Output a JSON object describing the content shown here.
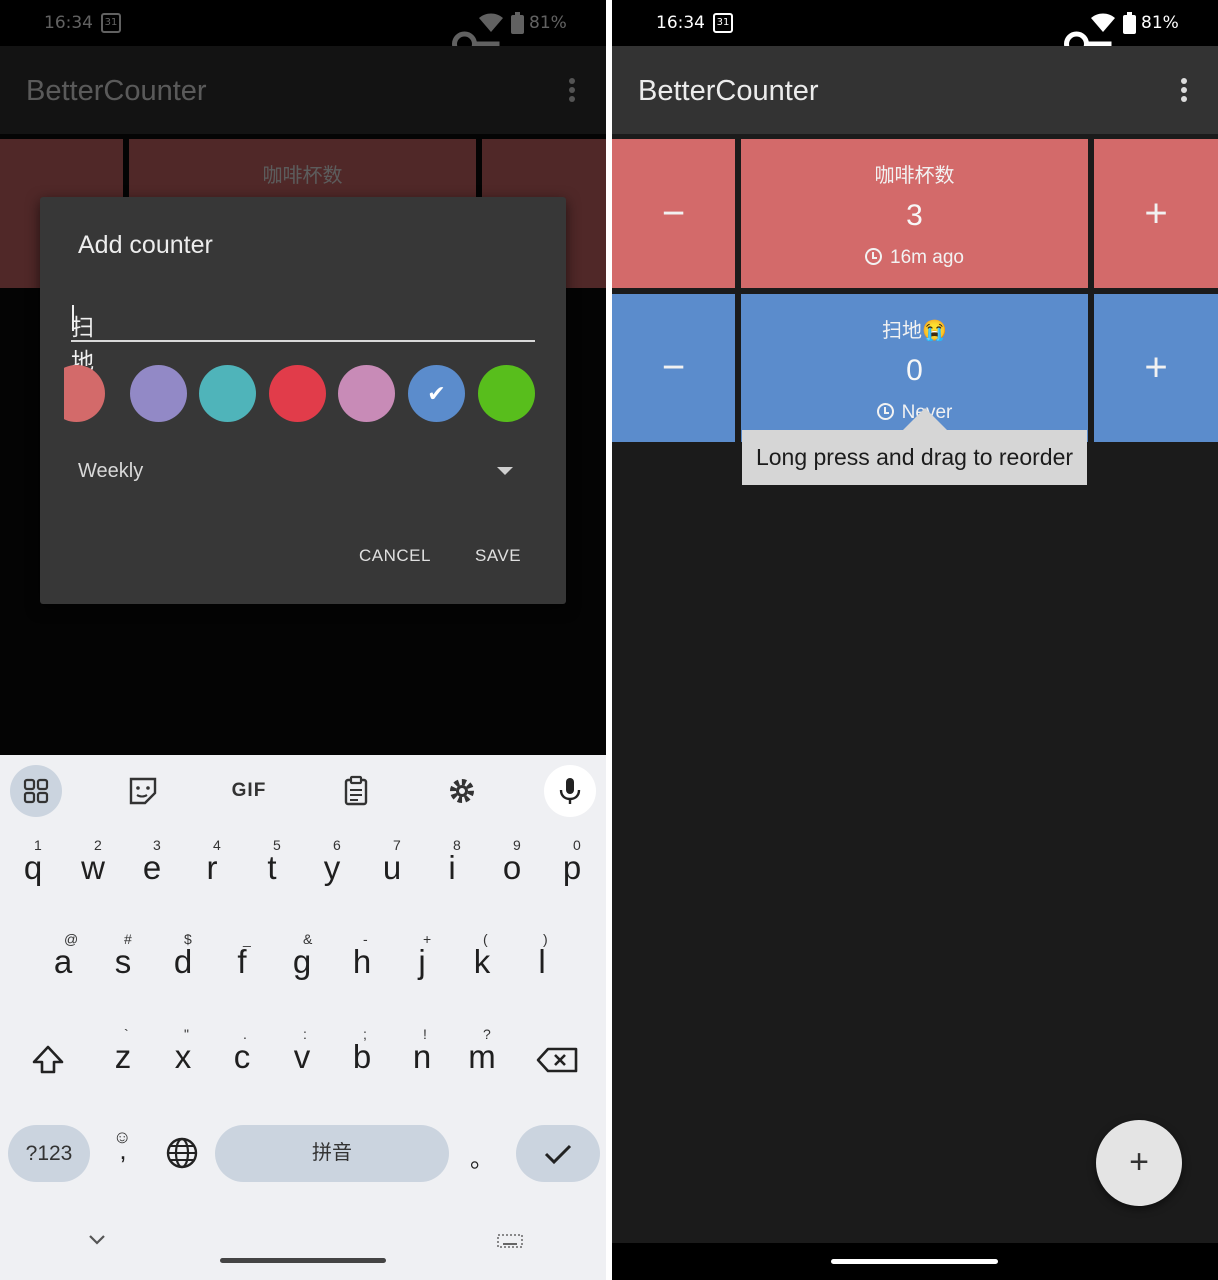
{
  "status": {
    "time": "16:34",
    "calendar_day": "31",
    "battery": "81%"
  },
  "app": {
    "title": "BetterCounter"
  },
  "counters": [
    {
      "name": "咖啡杯数",
      "count": "3",
      "last": "16m ago",
      "color": "#d36a6a",
      "minus": "−",
      "plus": "+"
    },
    {
      "name": "扫地😭",
      "count": "0",
      "last": "Never",
      "color": "#5b8ccc",
      "minus": "−",
      "plus": "+"
    }
  ],
  "dialog": {
    "title": "Add counter",
    "input_value": "扫地😭",
    "colors": [
      "#d36a6a",
      "#9289c6",
      "#4fb4ba",
      "#e13c4a",
      "#c88bb7",
      "#5b8ccc",
      "#58be1c"
    ],
    "selected_color_mark": "✔",
    "period": "Weekly",
    "cancel": "CANCEL",
    "save": "SAVE"
  },
  "keyboard": {
    "toolbar": {
      "gif": "GIF"
    },
    "row1": [
      {
        "k": "q",
        "h": "1"
      },
      {
        "k": "w",
        "h": "2"
      },
      {
        "k": "e",
        "h": "3"
      },
      {
        "k": "r",
        "h": "4"
      },
      {
        "k": "t",
        "h": "5"
      },
      {
        "k": "y",
        "h": "6"
      },
      {
        "k": "u",
        "h": "7"
      },
      {
        "k": "i",
        "h": "8"
      },
      {
        "k": "o",
        "h": "9"
      },
      {
        "k": "p",
        "h": "0"
      }
    ],
    "row2": [
      {
        "k": "a",
        "h": "@"
      },
      {
        "k": "s",
        "h": "#"
      },
      {
        "k": "d",
        "h": "$"
      },
      {
        "k": "f",
        "h": "_"
      },
      {
        "k": "g",
        "h": "&"
      },
      {
        "k": "h",
        "h": "-"
      },
      {
        "k": "j",
        "h": "+"
      },
      {
        "k": "k",
        "h": "("
      },
      {
        "k": "l",
        "h": ")"
      }
    ],
    "row3": [
      {
        "k": "z",
        "h": "`"
      },
      {
        "k": "x",
        "h": "\""
      },
      {
        "k": "c",
        "h": "."
      },
      {
        "k": "v",
        "h": ":"
      },
      {
        "k": "b",
        "h": ";"
      },
      {
        "k": "n",
        "h": "!"
      },
      {
        "k": "m",
        "h": "?"
      }
    ],
    "symbols": "?123",
    "comma": ",",
    "emoji": "☺",
    "space": "拼音",
    "period": "。"
  },
  "tooltip": "Long press and drag to reorder",
  "fab": "+"
}
